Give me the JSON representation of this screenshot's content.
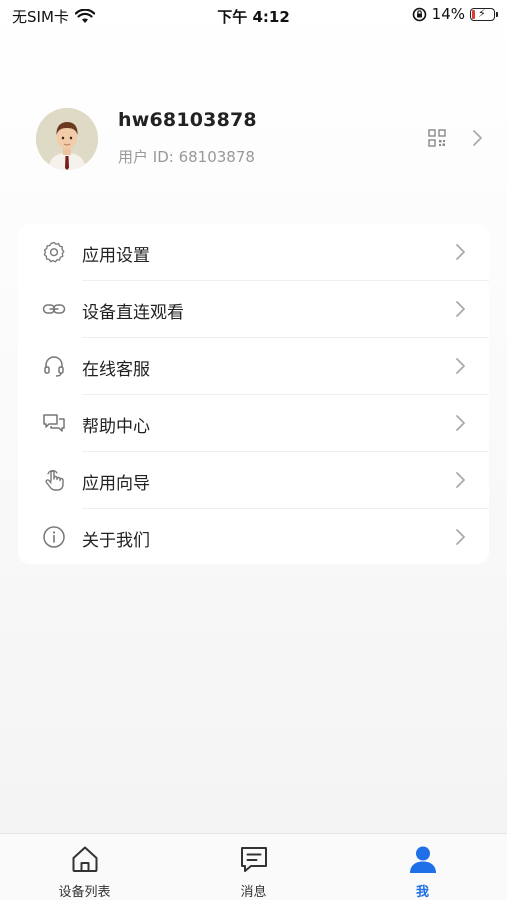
{
  "status_bar": {
    "carrier": "无SIM卡",
    "time": "下午 4:12",
    "battery_percent": "14%",
    "battery_level": 0.14,
    "battery_color": "#e53935"
  },
  "profile": {
    "username": "hw68103878",
    "user_id": "用户 ID: 68103878",
    "qr_icon": "qr-code-icon"
  },
  "menu": {
    "items": [
      {
        "label": "应用设置",
        "icon": "gear-icon"
      },
      {
        "label": "设备直连观看",
        "icon": "link-icon"
      },
      {
        "label": "在线客服",
        "icon": "headset-icon"
      },
      {
        "label": "帮助中心",
        "icon": "chat-bubbles-icon"
      },
      {
        "label": "应用向导",
        "icon": "hand-pointer-icon"
      },
      {
        "label": "关于我们",
        "icon": "info-icon"
      }
    ]
  },
  "tab_bar": {
    "accent_color": "#1e6fe8",
    "tabs": [
      {
        "label": "设备列表",
        "icon": "home-icon",
        "active": false
      },
      {
        "label": "消息",
        "icon": "message-icon",
        "active": false
      },
      {
        "label": "我",
        "icon": "person-icon",
        "active": true
      }
    ]
  }
}
